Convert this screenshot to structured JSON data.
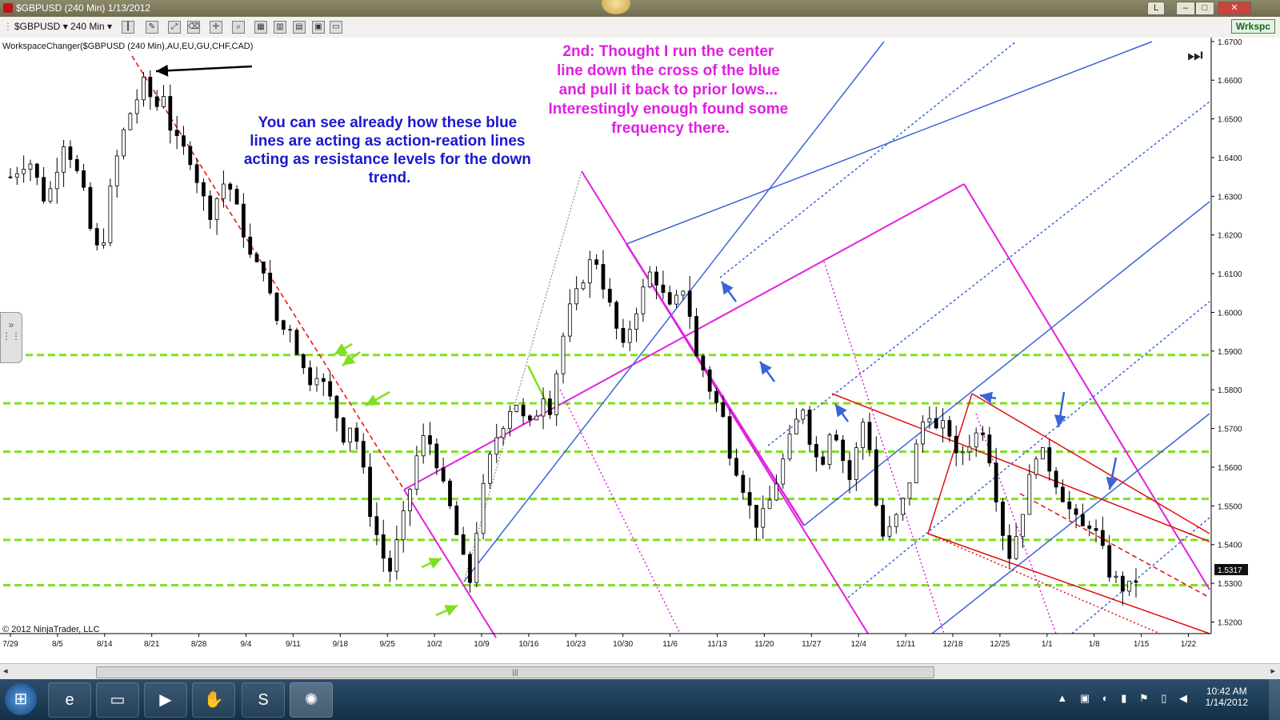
{
  "window": {
    "title": "$GBPUSD (240 Min)  1/13/2012",
    "buttons": [
      "L",
      "–",
      "□",
      "✕"
    ]
  },
  "toolbar": {
    "instrument": "$GBPUSD",
    "interval": "240 Min",
    "workspace_button": "Wrkspc"
  },
  "colors": {
    "price_bars": "#000000",
    "support_lines": "#7de11f",
    "blue_pitchfork": "#3c64d8",
    "magenta_pitchfork": "#e020e0",
    "red_pitchfork": "#e01010",
    "annotation_blue": "#1a1acc",
    "annotation_magenta": "#e020e0"
  },
  "chart_data": {
    "type": "candlestick",
    "indicator_label": "WorkspaceChanger($GBPUSD (240 Min),AU,EU,GU,CHF,CAD)",
    "copyright": "© 2012 NinjaTrader, LLC",
    "current_price_label": "1.5317",
    "x_tick_labels": [
      "7/29",
      "8/5",
      "8/14",
      "8/21",
      "8/28",
      "9/4",
      "9/11",
      "9/18",
      "9/25",
      "10/2",
      "10/9",
      "10/16",
      "10/23",
      "10/30",
      "11/6",
      "11/13",
      "11/20",
      "11/27",
      "12/4",
      "12/11",
      "12/18",
      "12/25",
      "1/1",
      "1/8",
      "1/15",
      "1/22"
    ],
    "y_tick_labels": [
      "1.5200",
      "1.5300",
      "1.5400",
      "1.5500",
      "1.5600",
      "1.5700",
      "1.5800",
      "1.5900",
      "1.6000",
      "1.6100",
      "1.6200",
      "1.6300",
      "1.6400",
      "1.6500",
      "1.6600",
      "1.6700"
    ],
    "ylim": [
      1.517,
      1.671
    ],
    "horizontal_levels": [
      1.589,
      1.5765,
      1.564,
      1.5518,
      1.5412,
      1.5295
    ],
    "price_path": [
      [
        0,
        1.635
      ],
      [
        2,
        1.64
      ],
      [
        4,
        1.628
      ],
      [
        6,
        1.645
      ],
      [
        8,
        1.632
      ],
      [
        9,
        1.62
      ],
      [
        10,
        1.614
      ],
      [
        11,
        1.63
      ],
      [
        12,
        1.642
      ],
      [
        13,
        1.65
      ],
      [
        15,
        1.66
      ],
      [
        16,
        1.652
      ],
      [
        17,
        1.657
      ],
      [
        18,
        1.645
      ],
      [
        20,
        1.64
      ],
      [
        22,
        1.625
      ],
      [
        24,
        1.635
      ],
      [
        26,
        1.62
      ],
      [
        27,
        1.611
      ],
      [
        28,
        1.613
      ],
      [
        29,
        1.602
      ],
      [
        30,
        1.595
      ],
      [
        31,
        1.597
      ],
      [
        32,
        1.589
      ],
      [
        33,
        1.582
      ],
      [
        34,
        1.585
      ],
      [
        36,
        1.575
      ],
      [
        37,
        1.568
      ],
      [
        38,
        1.572
      ],
      [
        39,
        1.561
      ],
      [
        40,
        1.548
      ],
      [
        41,
        1.54
      ],
      [
        42,
        1.532
      ],
      [
        43,
        1.541
      ],
      [
        44,
        1.55
      ],
      [
        45,
        1.562
      ],
      [
        46,
        1.568
      ],
      [
        47,
        1.565
      ],
      [
        48,
        1.555
      ],
      [
        49,
        1.548
      ],
      [
        50,
        1.538
      ],
      [
        51,
        1.53
      ],
      [
        52,
        1.548
      ],
      [
        53,
        1.56
      ],
      [
        54,
        1.568
      ],
      [
        56,
        1.578
      ],
      [
        57,
        1.572
      ],
      [
        58,
        1.57
      ],
      [
        59,
        1.58
      ],
      [
        60,
        1.575
      ],
      [
        61,
        1.59
      ],
      [
        62,
        1.6
      ],
      [
        63,
        1.605
      ],
      [
        64,
        1.612
      ],
      [
        65,
        1.614
      ],
      [
        66,
        1.606
      ],
      [
        67,
        1.598
      ],
      [
        68,
        1.59
      ],
      [
        69,
        1.598
      ],
      [
        70,
        1.604
      ],
      [
        71,
        1.61
      ],
      [
        72,
        1.608
      ],
      [
        73,
        1.6
      ],
      [
        74,
        1.603
      ],
      [
        75,
        1.608
      ],
      [
        76,
        1.589
      ],
      [
        77,
        1.585
      ],
      [
        78,
        1.578
      ],
      [
        79,
        1.574
      ],
      [
        80,
        1.563
      ],
      [
        81,
        1.558
      ],
      [
        82,
        1.55
      ],
      [
        83,
        1.545
      ],
      [
        84,
        1.549
      ],
      [
        85,
        1.556
      ],
      [
        86,
        1.563
      ],
      [
        87,
        1.57
      ],
      [
        88,
        1.576
      ],
      [
        89,
        1.565
      ],
      [
        90,
        1.56
      ],
      [
        91,
        1.57
      ],
      [
        92,
        1.568
      ],
      [
        93,
        1.555
      ],
      [
        94,
        1.565
      ],
      [
        95,
        1.575
      ],
      [
        96,
        1.552
      ],
      [
        97,
        1.541
      ],
      [
        98,
        1.545
      ],
      [
        99,
        1.55
      ],
      [
        100,
        1.558
      ],
      [
        101,
        1.57
      ],
      [
        102,
        1.575
      ],
      [
        103,
        1.568
      ],
      [
        104,
        1.572
      ],
      [
        105,
        1.562
      ],
      [
        106,
        1.565
      ],
      [
        107,
        1.568
      ],
      [
        108,
        1.57
      ],
      [
        109,
        1.56
      ],
      [
        110,
        1.545
      ],
      [
        111,
        1.537
      ],
      [
        112,
        1.545
      ],
      [
        113,
        1.555
      ],
      [
        114,
        1.565
      ],
      [
        115,
        1.562
      ],
      [
        116,
        1.557
      ],
      [
        117,
        1.552
      ],
      [
        118,
        1.547
      ],
      [
        119,
        1.544
      ],
      [
        120,
        1.546
      ],
      [
        121,
        1.54
      ],
      [
        122,
        1.533
      ],
      [
        123,
        1.53
      ],
      [
        124,
        1.528
      ],
      [
        125,
        1.531
      ]
    ],
    "annotations": [
      "You can see already how these blue lines are acting as action-reation lines acting as resistance levels for the down trend.",
      "2nd: Thought I run the center line down the cross of the blue and pull it back to prior lows... Interestingly enough found some frequency there."
    ]
  },
  "taskbar": {
    "time": "10:42 AM",
    "date": "1/14/2012"
  }
}
